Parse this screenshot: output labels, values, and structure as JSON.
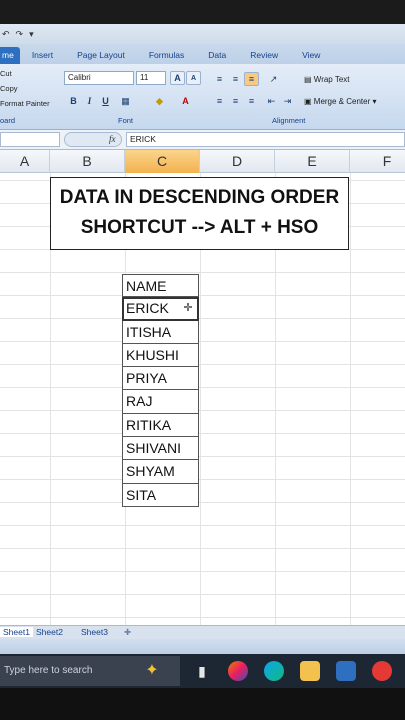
{
  "quick_access": {
    "undo_icon": "↶",
    "redo_icon": "↷",
    "customize_icon": "▾"
  },
  "ribbon_tabs": [
    "me",
    "Insert",
    "Page Layout",
    "Formulas",
    "Data",
    "Review",
    "View"
  ],
  "ribbon": {
    "clipboard": {
      "cut": "Cut",
      "copy": "Copy",
      "format_painter": "Format Painter",
      "group_label": "oard"
    },
    "font": {
      "font_name": "Calibri",
      "font_size": "11",
      "group_label": "Font"
    },
    "alignment": {
      "wrap_text": "Wrap Text",
      "merge_center": "Merge & Center",
      "group_label": "Alignment"
    }
  },
  "formula_bar": {
    "name_box": "",
    "fx": "fx",
    "value": "ERICK"
  },
  "columns": [
    "A",
    "B",
    "C",
    "D",
    "E",
    "F"
  ],
  "selected_column": "C",
  "title_box": {
    "line1": "DATA IN DESCENDING ORDER",
    "line2": "SHORTCUT --> ALT + HSO"
  },
  "table": {
    "header": "NAME",
    "rows": [
      "ERICK",
      "ITISHA",
      "KHUSHI",
      "PRIYA",
      "RAJ",
      "RITIKA",
      "SHIVANI",
      "SHYAM",
      "SITA"
    ],
    "active_row": 0
  },
  "sheets": [
    "Sheet1",
    "Sheet2",
    "Sheet3"
  ],
  "active_sheet": "Sheet1",
  "taskbar": {
    "search_placeholder": "Type here to search"
  },
  "colors": {
    "accent": "#2f6fbf",
    "selected_header": "#f3b24f",
    "taskbar": "#1d2633"
  }
}
